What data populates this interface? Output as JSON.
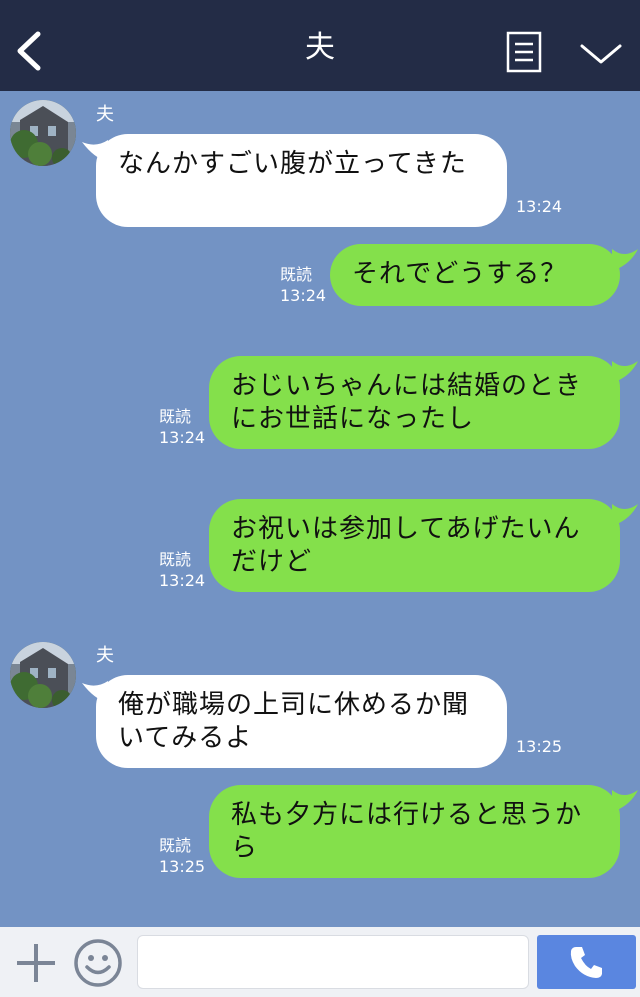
{
  "header": {
    "title": "夫"
  },
  "messages": [
    {
      "sender": "夫",
      "text": "なんかすごい腹が立ってきた",
      "time": "13:24"
    },
    {
      "text": "それでどうする？",
      "read": "既読",
      "time": "13:24"
    },
    {
      "text": "おじいちゃんには結婚のときにお世話になったし",
      "read": "既読",
      "time": "13:24"
    },
    {
      "text": "お祝いは参加してあげたいんだけど",
      "read": "既読",
      "time": "13:24"
    },
    {
      "sender": "夫",
      "text": "俺が職場の上司に休めるか聞いてみるよ",
      "time": "13:25"
    },
    {
      "text": "私も夕方には行けると思うから",
      "read": "既読",
      "time": "13:25"
    }
  ],
  "icons": {
    "back": "chevron-left-icon",
    "menu": "list-icon",
    "collapse": "chevron-down-icon",
    "add": "plus-icon",
    "emoji": "smiley-icon",
    "call": "phone-icon"
  },
  "colors": {
    "header_bg": "#232c46",
    "chat_bg": "#7393c4",
    "outgoing_bubble": "#84e04b",
    "incoming_bubble": "#ffffff",
    "call_button": "#5a86e0"
  }
}
